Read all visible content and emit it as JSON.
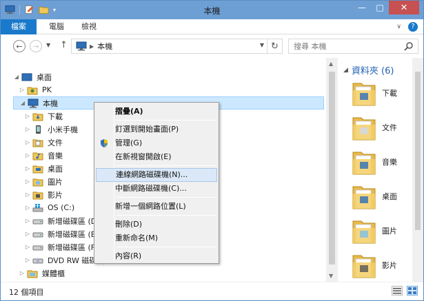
{
  "window": {
    "title": "本機",
    "controls": {
      "minimize": "—",
      "maximize": "□",
      "close": "✕"
    }
  },
  "ribbon": {
    "tabs": [
      "檔案",
      "電腦",
      "檢視"
    ],
    "help": "?"
  },
  "address": {
    "path": "本機",
    "search_placeholder": "搜尋 本機"
  },
  "nav_tree": {
    "items": [
      {
        "label": "桌面",
        "icon": "desktop-icon",
        "level": 0,
        "expanded": true
      },
      {
        "label": "PK",
        "icon": "user-folder-icon",
        "level": 1
      },
      {
        "label": "本機",
        "icon": "computer-icon",
        "level": 1,
        "expanded": true,
        "selected": true
      },
      {
        "label": "下載",
        "icon": "downloads-folder-icon",
        "level": 2
      },
      {
        "label": "小米手機",
        "icon": "phone-icon",
        "level": 2
      },
      {
        "label": "文件",
        "icon": "documents-folder-icon",
        "level": 2
      },
      {
        "label": "音樂",
        "icon": "music-folder-icon",
        "level": 2
      },
      {
        "label": "桌面",
        "icon": "desktop-folder-icon",
        "level": 2
      },
      {
        "label": "圖片",
        "icon": "pictures-folder-icon",
        "level": 2
      },
      {
        "label": "影片",
        "icon": "videos-folder-icon",
        "level": 2
      },
      {
        "label": "OS (C:)",
        "icon": "windows-drive-icon",
        "level": 2
      },
      {
        "label": "新增磁碟區 (D:)",
        "icon": "drive-icon",
        "level": 2
      },
      {
        "label": "新增磁碟區 (E:)",
        "icon": "drive-icon",
        "level": 2
      },
      {
        "label": "新增磁碟區 (F:)",
        "icon": "drive-icon",
        "level": 2
      },
      {
        "label": "DVD RW 磁碟機",
        "icon": "dvd-drive-icon",
        "level": 2
      },
      {
        "label": "媒體櫃",
        "icon": "libraries-icon",
        "level": 1
      }
    ]
  },
  "details": {
    "title": "資料夾 (6)",
    "folders": [
      "下載",
      "文件",
      "音樂",
      "桌面",
      "圖片",
      "影片"
    ]
  },
  "context_menu": {
    "items": [
      {
        "label": "摺疊(A)",
        "bold": true
      },
      {
        "separator": true
      },
      {
        "label": "釘選到開始畫面(P)"
      },
      {
        "label": "管理(G)",
        "icon": "uac-shield-icon"
      },
      {
        "label": "在新視窗開啟(E)"
      },
      {
        "separator": true
      },
      {
        "label": "連線網路磁碟機(N)...",
        "highlighted": true
      },
      {
        "label": "中斷網路磁碟機(C)..."
      },
      {
        "separator": true
      },
      {
        "label": "新增一個網路位置(L)"
      },
      {
        "separator": true
      },
      {
        "label": "刪除(D)"
      },
      {
        "label": "重新命名(M)"
      },
      {
        "separator": true
      },
      {
        "label": "內容(R)"
      }
    ]
  },
  "status": {
    "count": "12 個項目"
  },
  "colors": {
    "accent": "#1979ca",
    "selection": "#cce8ff",
    "menu_highlight": "#dbe8f7"
  }
}
